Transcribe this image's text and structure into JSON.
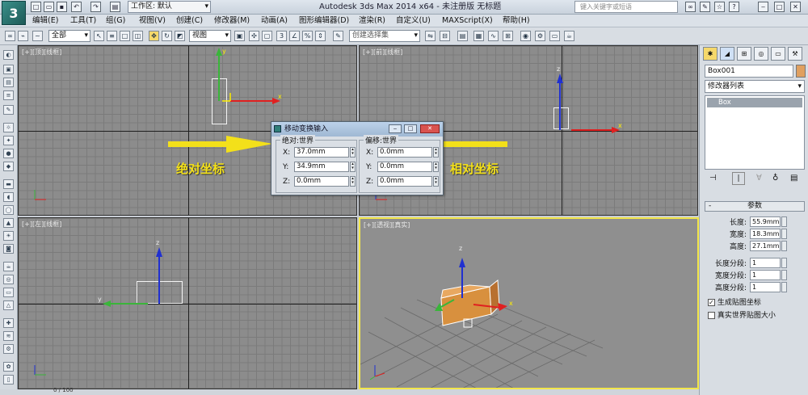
{
  "app": {
    "title": "Autodesk 3ds Max  2014 x64  - 未注册版  无标题",
    "workspace_label": "工作区: 默认",
    "search_placeholder": "键入关键字或短语"
  },
  "menus": [
    "编辑(E)",
    "工具(T)",
    "组(G)",
    "视图(V)",
    "创建(C)",
    "修改器(M)",
    "动画(A)",
    "图形编辑器(D)",
    "渲染(R)",
    "自定义(U)",
    "MAXScript(X)",
    "帮助(H)"
  ],
  "toolbar": {
    "selection_filter": "全部",
    "ref_coord": "视图",
    "named_selection": "创建选择集"
  },
  "viewports": [
    {
      "label": "[+][顶][线框]"
    },
    {
      "label": "[+][前][线框]"
    },
    {
      "label": "[+][左][线框]"
    },
    {
      "label": "[+][透视][真实]"
    }
  ],
  "axis_labels": {
    "x": "x",
    "y": "y",
    "z": "z"
  },
  "dialog": {
    "title": "移动变换输入",
    "absolute": {
      "label": "绝对:世界",
      "rows": [
        {
          "axis": "X:",
          "value": "37.0mm"
        },
        {
          "axis": "Y:",
          "value": "34.9mm"
        },
        {
          "axis": "Z:",
          "value": "0.0mm"
        }
      ]
    },
    "offset": {
      "label": "偏移:世界",
      "rows": [
        {
          "axis": "X:",
          "value": "0.0mm"
        },
        {
          "axis": "Y:",
          "value": "0.0mm"
        },
        {
          "axis": "Z:",
          "value": "0.0mm"
        }
      ]
    }
  },
  "annotations": {
    "absolute": "绝对坐标",
    "relative": "相对坐标",
    "color": "#f3e01a"
  },
  "command_panel": {
    "object_name": "Box001",
    "object_color": "#e0a060",
    "modifier_list": "修改器列表",
    "stack_item": "Box",
    "rollout_title": "参数",
    "params": [
      {
        "label": "长度:",
        "value": "55.9mm"
      },
      {
        "label": "宽度:",
        "value": "18.3mm"
      },
      {
        "label": "高度:",
        "value": "27.1mm"
      }
    ],
    "segments": [
      {
        "label": "长度分段:",
        "value": "1"
      },
      {
        "label": "宽度分段:",
        "value": "1"
      },
      {
        "label": "高度分段:",
        "value": "1"
      }
    ],
    "checkboxes": [
      {
        "label": "生成贴图坐标",
        "checked": true
      },
      {
        "label": "真实世界贴图大小",
        "checked": false
      }
    ]
  },
  "status": {
    "frame": "0 / 100"
  }
}
